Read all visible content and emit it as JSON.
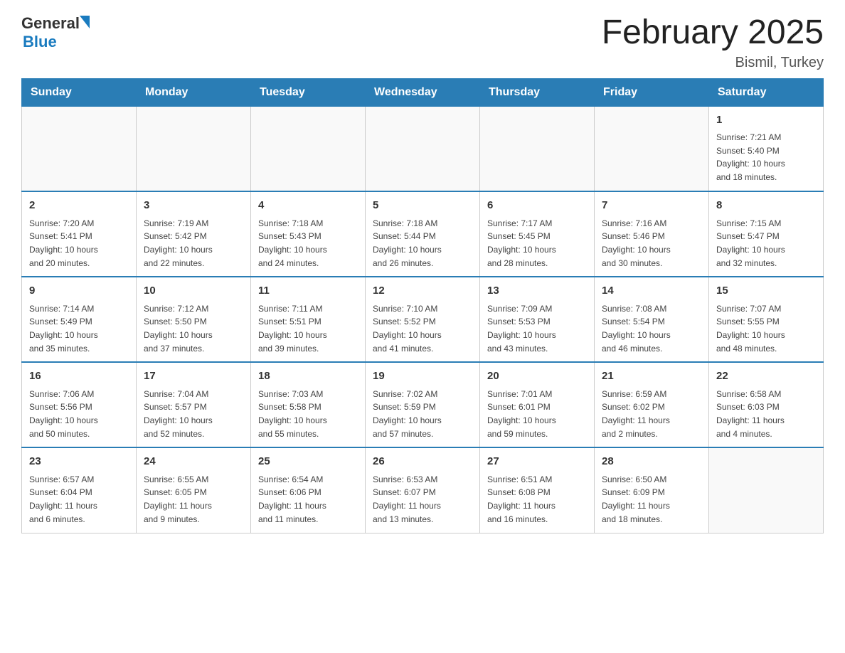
{
  "header": {
    "logo_general": "General",
    "logo_blue": "Blue",
    "title": "February 2025",
    "subtitle": "Bismil, Turkey"
  },
  "days_of_week": [
    "Sunday",
    "Monday",
    "Tuesday",
    "Wednesday",
    "Thursday",
    "Friday",
    "Saturday"
  ],
  "weeks": [
    [
      {
        "date": "",
        "info": ""
      },
      {
        "date": "",
        "info": ""
      },
      {
        "date": "",
        "info": ""
      },
      {
        "date": "",
        "info": ""
      },
      {
        "date": "",
        "info": ""
      },
      {
        "date": "",
        "info": ""
      },
      {
        "date": "1",
        "info": "Sunrise: 7:21 AM\nSunset: 5:40 PM\nDaylight: 10 hours\nand 18 minutes."
      }
    ],
    [
      {
        "date": "2",
        "info": "Sunrise: 7:20 AM\nSunset: 5:41 PM\nDaylight: 10 hours\nand 20 minutes."
      },
      {
        "date": "3",
        "info": "Sunrise: 7:19 AM\nSunset: 5:42 PM\nDaylight: 10 hours\nand 22 minutes."
      },
      {
        "date": "4",
        "info": "Sunrise: 7:18 AM\nSunset: 5:43 PM\nDaylight: 10 hours\nand 24 minutes."
      },
      {
        "date": "5",
        "info": "Sunrise: 7:18 AM\nSunset: 5:44 PM\nDaylight: 10 hours\nand 26 minutes."
      },
      {
        "date": "6",
        "info": "Sunrise: 7:17 AM\nSunset: 5:45 PM\nDaylight: 10 hours\nand 28 minutes."
      },
      {
        "date": "7",
        "info": "Sunrise: 7:16 AM\nSunset: 5:46 PM\nDaylight: 10 hours\nand 30 minutes."
      },
      {
        "date": "8",
        "info": "Sunrise: 7:15 AM\nSunset: 5:47 PM\nDaylight: 10 hours\nand 32 minutes."
      }
    ],
    [
      {
        "date": "9",
        "info": "Sunrise: 7:14 AM\nSunset: 5:49 PM\nDaylight: 10 hours\nand 35 minutes."
      },
      {
        "date": "10",
        "info": "Sunrise: 7:12 AM\nSunset: 5:50 PM\nDaylight: 10 hours\nand 37 minutes."
      },
      {
        "date": "11",
        "info": "Sunrise: 7:11 AM\nSunset: 5:51 PM\nDaylight: 10 hours\nand 39 minutes."
      },
      {
        "date": "12",
        "info": "Sunrise: 7:10 AM\nSunset: 5:52 PM\nDaylight: 10 hours\nand 41 minutes."
      },
      {
        "date": "13",
        "info": "Sunrise: 7:09 AM\nSunset: 5:53 PM\nDaylight: 10 hours\nand 43 minutes."
      },
      {
        "date": "14",
        "info": "Sunrise: 7:08 AM\nSunset: 5:54 PM\nDaylight: 10 hours\nand 46 minutes."
      },
      {
        "date": "15",
        "info": "Sunrise: 7:07 AM\nSunset: 5:55 PM\nDaylight: 10 hours\nand 48 minutes."
      }
    ],
    [
      {
        "date": "16",
        "info": "Sunrise: 7:06 AM\nSunset: 5:56 PM\nDaylight: 10 hours\nand 50 minutes."
      },
      {
        "date": "17",
        "info": "Sunrise: 7:04 AM\nSunset: 5:57 PM\nDaylight: 10 hours\nand 52 minutes."
      },
      {
        "date": "18",
        "info": "Sunrise: 7:03 AM\nSunset: 5:58 PM\nDaylight: 10 hours\nand 55 minutes."
      },
      {
        "date": "19",
        "info": "Sunrise: 7:02 AM\nSunset: 5:59 PM\nDaylight: 10 hours\nand 57 minutes."
      },
      {
        "date": "20",
        "info": "Sunrise: 7:01 AM\nSunset: 6:01 PM\nDaylight: 10 hours\nand 59 minutes."
      },
      {
        "date": "21",
        "info": "Sunrise: 6:59 AM\nSunset: 6:02 PM\nDaylight: 11 hours\nand 2 minutes."
      },
      {
        "date": "22",
        "info": "Sunrise: 6:58 AM\nSunset: 6:03 PM\nDaylight: 11 hours\nand 4 minutes."
      }
    ],
    [
      {
        "date": "23",
        "info": "Sunrise: 6:57 AM\nSunset: 6:04 PM\nDaylight: 11 hours\nand 6 minutes."
      },
      {
        "date": "24",
        "info": "Sunrise: 6:55 AM\nSunset: 6:05 PM\nDaylight: 11 hours\nand 9 minutes."
      },
      {
        "date": "25",
        "info": "Sunrise: 6:54 AM\nSunset: 6:06 PM\nDaylight: 11 hours\nand 11 minutes."
      },
      {
        "date": "26",
        "info": "Sunrise: 6:53 AM\nSunset: 6:07 PM\nDaylight: 11 hours\nand 13 minutes."
      },
      {
        "date": "27",
        "info": "Sunrise: 6:51 AM\nSunset: 6:08 PM\nDaylight: 11 hours\nand 16 minutes."
      },
      {
        "date": "28",
        "info": "Sunrise: 6:50 AM\nSunset: 6:09 PM\nDaylight: 11 hours\nand 18 minutes."
      },
      {
        "date": "",
        "info": ""
      }
    ]
  ]
}
